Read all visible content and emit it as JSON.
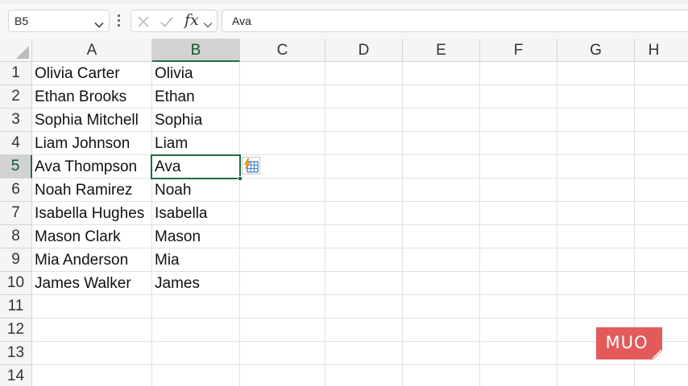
{
  "formula_bar": {
    "name_box": "B5",
    "fx_label": "fx",
    "formula": "Ava"
  },
  "columns": [
    "A",
    "B",
    "C",
    "D",
    "E",
    "F",
    "G",
    "H"
  ],
  "rows": [
    "1",
    "2",
    "3",
    "4",
    "5",
    "6",
    "7",
    "8",
    "9",
    "10",
    "11",
    "12",
    "13",
    "14"
  ],
  "selected_cell": "B5",
  "cells": {
    "A": [
      "Olivia Carter",
      "Ethan Brooks",
      "Sophia Mitchell",
      "Liam Johnson",
      "Ava Thompson",
      "Noah Ramirez",
      "Isabella Hughes",
      "Mason Clark",
      "Mia Anderson",
      "James Walker"
    ],
    "B": [
      "Olivia",
      "Ethan",
      "Sophia",
      "Liam",
      "Ava",
      "Noah",
      "Isabella",
      "Mason",
      "Mia",
      "James"
    ]
  },
  "watermark": {
    "text": "MUO",
    "color": "#e45a5a"
  },
  "colors": {
    "accent": "#1e6e42",
    "header_bg": "#f5f5f5",
    "header_selected_bg": "#d2d2d2",
    "gridline": "#e1e1e1"
  },
  "icons": {
    "name_box_dropdown": "chevron-down-icon",
    "cancel": "close-icon",
    "enter": "check-icon",
    "function": "fx-icon",
    "flash_fill": "flash-fill-icon"
  }
}
